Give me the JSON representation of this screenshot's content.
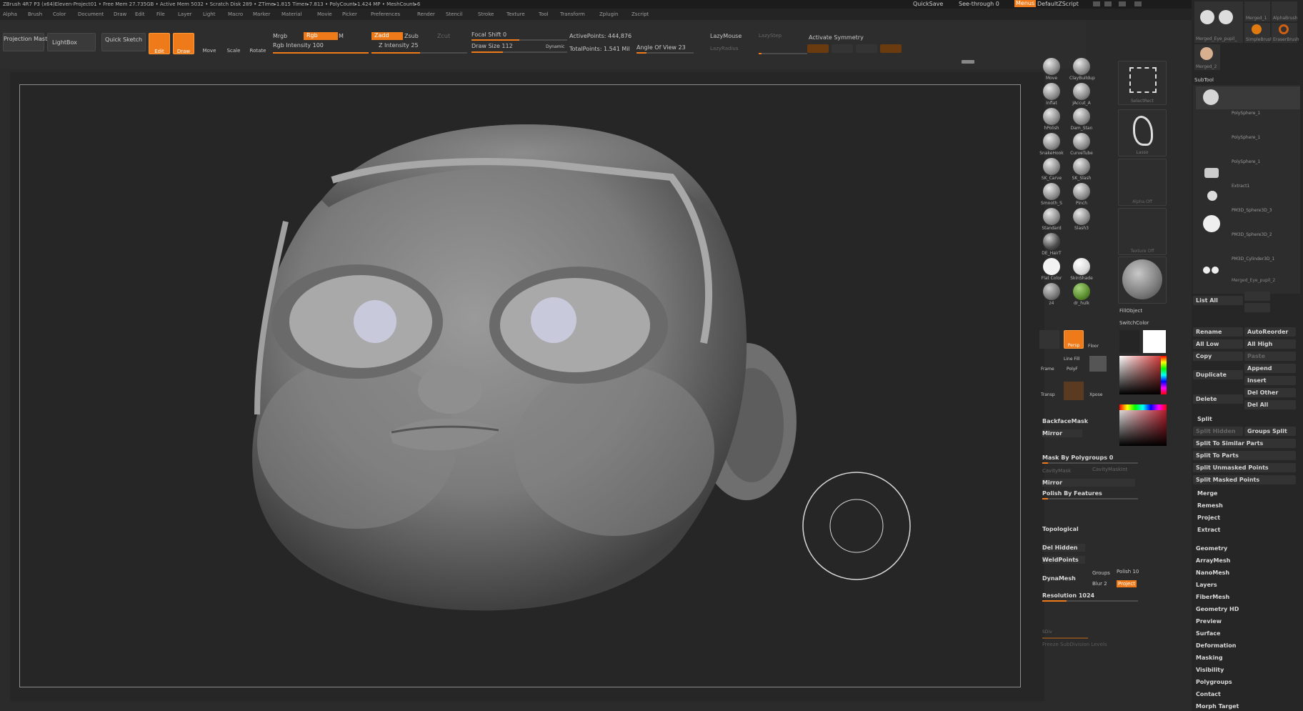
{
  "titlebar": {
    "text": "ZBrush 4R7 P3 (x64)Eleven-Project01    • Free Mem 27.735GB • Active Mem 5032 • Scratch Disk 289 •  ZTime▸1.815 Timer▸7.813 • PolyCount▸1.424 MP • MeshCount▸6",
    "quicksave": "QuickSave",
    "seethrough": "See-through  0",
    "menus": "Menus",
    "script": "DefaultZScript"
  },
  "menubar": [
    "Alpha",
    "Brush",
    "Color",
    "Document",
    "Draw",
    "Edit",
    "File",
    "Layer",
    "Light",
    "Macro",
    "Marker",
    "Material",
    "Movie",
    "Picker",
    "Preferences",
    "Render",
    "Stencil",
    "Stroke",
    "Texture",
    "Tool",
    "Transform",
    "Zplugin",
    "Zscript"
  ],
  "toolbar": {
    "projection_master": "Projection Master",
    "lightbox": "LightBox",
    "quick_sketch": "Quick Sketch",
    "edit": "Edit",
    "draw": "Draw",
    "move": "Move",
    "scale": "Scale",
    "rotate": "Rotate",
    "mrgb": "Mrgb",
    "rgb": "Rgb",
    "m": "M",
    "rgb_intensity": "Rgb Intensity 100",
    "zadd": "Zadd",
    "zsub": "Zsub",
    "zcut": "Zcut",
    "z_intensity": "Z Intensity 25",
    "focal_shift": "Focal Shift 0",
    "draw_size": "Draw Size 112",
    "dynamic": "Dynamic",
    "active_points": "ActivePoints: 444,876",
    "total_points": "TotalPoints: 1.541 Mil",
    "angle_of_view": "Angle Of View 23",
    "lazymouse": "LazyMouse",
    "lazystep": "LazyStep",
    "lazyradius": "LazyRadius",
    "activate_symmetry": "Activate Symmetry"
  },
  "brushes": [
    {
      "label": "Move"
    },
    {
      "label": "ClayBuildup"
    },
    {
      "label": "Inflat"
    },
    {
      "label": "JAccut_A"
    },
    {
      "label": "hPolish"
    },
    {
      "label": "Dam_Stan"
    },
    {
      "label": "SnakeHook"
    },
    {
      "label": "CurveTube"
    },
    {
      "label": "SK_Carve"
    },
    {
      "label": "SK_Slash"
    },
    {
      "label": "Smooth_S"
    },
    {
      "label": "Pinch"
    },
    {
      "label": "Standard"
    },
    {
      "label": "Slash3"
    },
    {
      "label": "DE_HairT"
    }
  ],
  "materials": [
    {
      "label": "Flat Color"
    },
    {
      "label": "SkinShade"
    },
    {
      "label": "z4"
    },
    {
      "label": "dr_hulk"
    }
  ],
  "midcol": {
    "selectrect": "SelectRect",
    "lasso": "Lasso",
    "alpha_off": "Alpha Off",
    "texture_off": "Texture Off",
    "fillobject": "FillObject",
    "switchcolor": "SwitchColor"
  },
  "leftlower": {
    "persp": "Persp",
    "floor": "Floor",
    "frame": "Frame",
    "polyf": "PolyF",
    "line_fill": "Line Fill",
    "transp": "Transp",
    "xpose": "Xpose",
    "backfacemask": "BackfaceMask",
    "mirror": "Mirror",
    "mask_by_polygroups": "Mask By Polygroups 0",
    "cavitymask": "CavityMask",
    "cavitymaskint": "CavityMaskInt",
    "mirror2": "Mirror",
    "polish_by_features": "Polish By Features",
    "topological": "Topological",
    "del_hidden": "Del Hidden",
    "weldpoints": "WeldPoints",
    "dynamesh": "DynaMesh",
    "groups": "Groups",
    "polish": "Polish 10",
    "blur": "Blur 2",
    "project": "Project",
    "resolution": "Resolution 1024",
    "sdiv": "SDiv",
    "freeze": "Freeze SubDivision Levels"
  },
  "rightpanel": {
    "top_thumbs": [
      {
        "label": "Merged_Eye_pupil_"
      },
      {
        "label": "Merged_1"
      },
      {
        "label": "AlphaBrush"
      },
      {
        "label": "SimpleBrush"
      },
      {
        "label": "EraserBrush"
      },
      {
        "label": "Merged_2"
      }
    ],
    "subtool_title": "SubTool",
    "subtools": [
      "",
      "PolySphere_1",
      "PolySphere_1",
      "PolySphere_1",
      "Extract1",
      "PM3D_Sphere3D_3",
      "PM3D_Sphere3D_2",
      "PM3D_Cylinder3D_1",
      "Merged_Eye_pupil_2"
    ],
    "list_all": "List All",
    "rename": "Rename",
    "autoreorder": "AutoReorder",
    "all_low": "All Low",
    "all_high": "All High",
    "copy": "Copy",
    "paste": "Paste",
    "append": "Append",
    "duplicate": "Duplicate",
    "insert": "Insert",
    "delete": "Delete",
    "del_other": "Del Other",
    "del_all": "Del All",
    "split": "Split",
    "split_hidden": "Split Hidden",
    "groups_split": "Groups Split",
    "split_similar": "Split To Similar Parts",
    "split_parts": "Split To Parts",
    "split_unmasked": "Split Unmasked Points",
    "split_masked": "Split Masked Points",
    "merge": "Merge",
    "remesh": "Remesh",
    "project": "Project",
    "extract": "Extract",
    "menus": [
      "Geometry",
      "ArrayMesh",
      "NanoMesh",
      "Layers",
      "FiberMesh",
      "Geometry HD",
      "Preview",
      "Surface",
      "Deformation",
      "Masking",
      "Visibility",
      "Polygroups",
      "Contact",
      "Morph Target"
    ]
  }
}
